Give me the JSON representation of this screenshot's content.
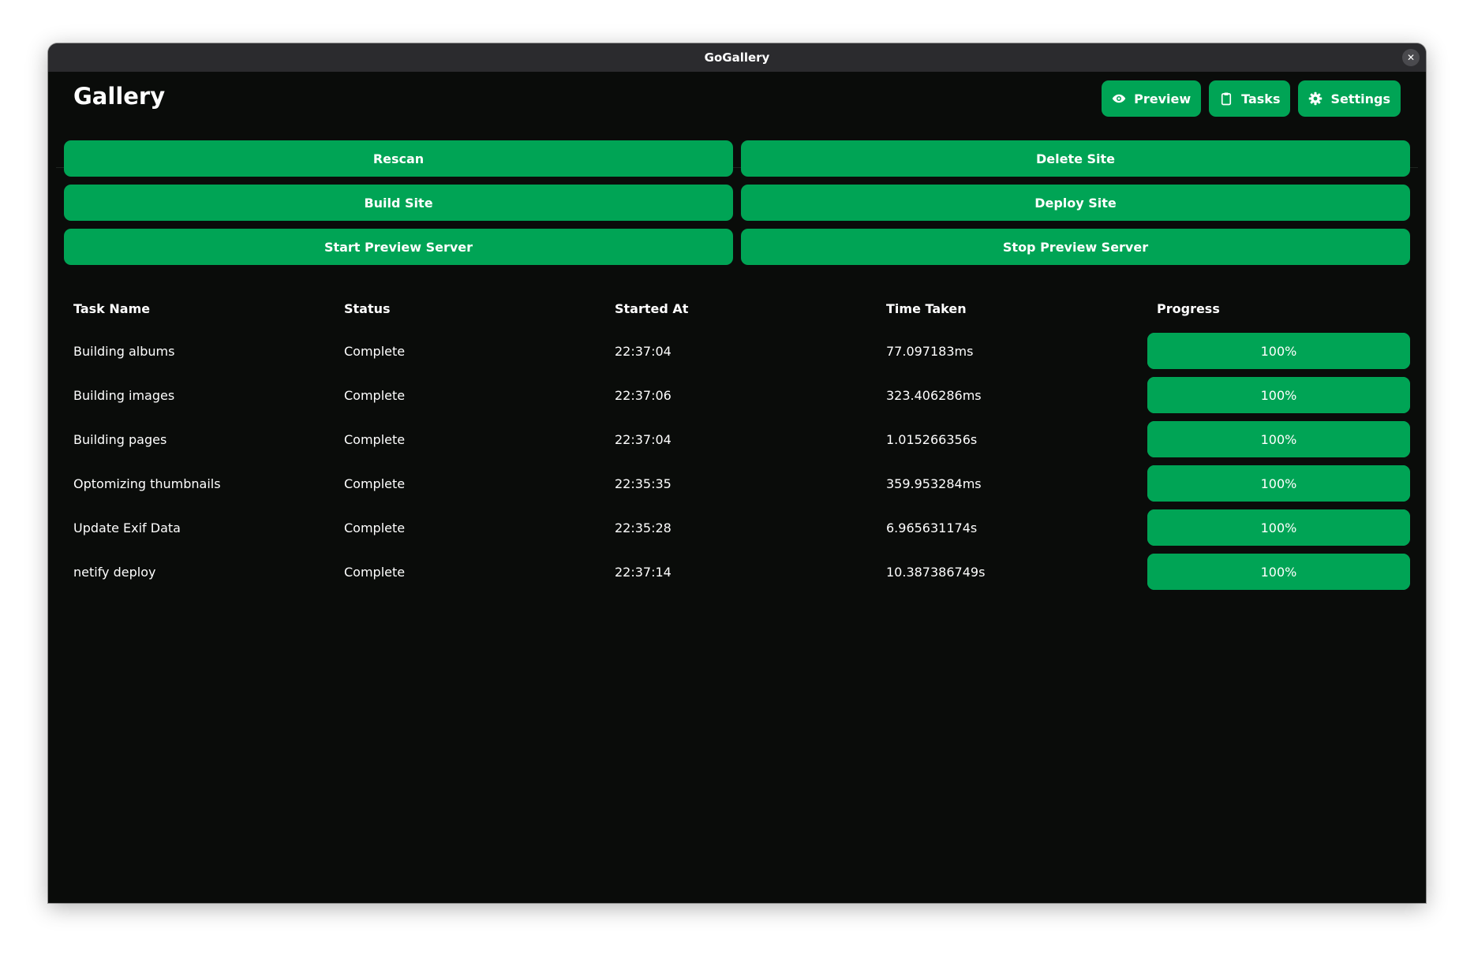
{
  "window": {
    "title": "GoGallery",
    "close_icon": "close-icon"
  },
  "header": {
    "title": "Gallery",
    "nav": [
      {
        "label": "Preview",
        "icon": "eye-icon"
      },
      {
        "label": "Tasks",
        "icon": "clipboard-icon"
      },
      {
        "label": "Settings",
        "icon": "gear-icon"
      }
    ]
  },
  "actions": {
    "rescan": "Rescan",
    "delete_site": "Delete Site",
    "build_site": "Build Site",
    "deploy_site": "Deploy Site",
    "start_preview": "Start Preview Server",
    "stop_preview": "Stop Preview Server"
  },
  "table": {
    "columns": [
      "Task Name",
      "Status",
      "Started At",
      "Time Taken",
      "Progress"
    ],
    "rows": [
      {
        "name": "Building albums",
        "status": "Complete",
        "started": "22:37:04",
        "taken": "77.097183ms",
        "progress": 1.0,
        "progress_label": "100%"
      },
      {
        "name": "Building images",
        "status": "Complete",
        "started": "22:37:06",
        "taken": "323.406286ms",
        "progress": 1.0,
        "progress_label": "100%"
      },
      {
        "name": "Building pages",
        "status": "Complete",
        "started": "22:37:04",
        "taken": "1.015266356s",
        "progress": 1.0,
        "progress_label": "100%"
      },
      {
        "name": "Optomizing thumbnails",
        "status": "Complete",
        "started": "22:35:35",
        "taken": "359.953284ms",
        "progress": 1.0,
        "progress_label": "100%"
      },
      {
        "name": "Update Exif Data",
        "status": "Complete",
        "started": "22:35:28",
        "taken": "6.965631174s",
        "progress": 1.0,
        "progress_label": "100%"
      },
      {
        "name": "netify deploy",
        "status": "Complete",
        "started": "22:37:14",
        "taken": "10.387386749s",
        "progress": 1.0,
        "progress_label": "100%"
      }
    ]
  },
  "colors": {
    "accent": "#00a455",
    "background": "#0a0c0a",
    "titlebar": "#2b2b2e"
  }
}
